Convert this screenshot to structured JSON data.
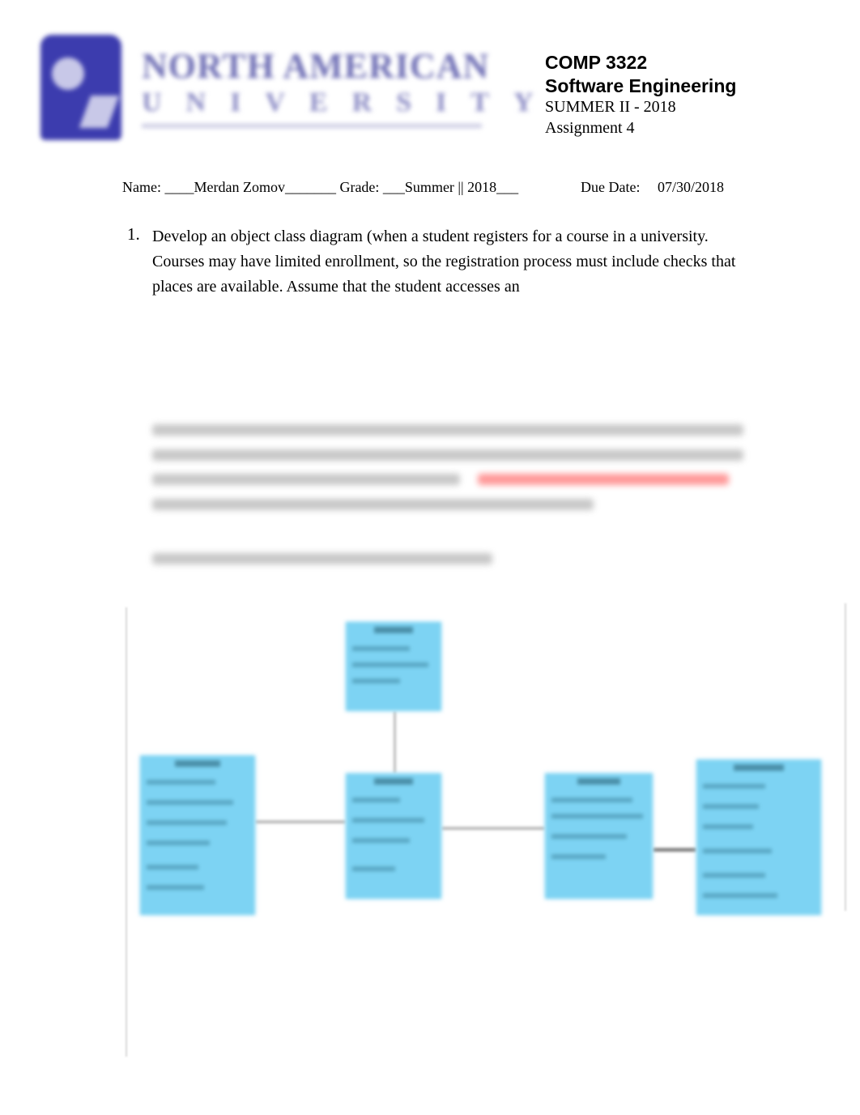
{
  "logo": {
    "name": "NORTH AMERICAN UNIVERSITY",
    "line1": "NORTH AMERICAN",
    "line2": "UNIVERSITY",
    "color": "#3c3cae"
  },
  "header": {
    "course_code": "COMP 3322",
    "course_name": "Software Engineering",
    "term": "SUMMER II - 2018",
    "assignment": "Assignment 4"
  },
  "info": {
    "name_line": "Name: ____Merdan Zomov_______ Grade: ___Summer || 2018___",
    "due_label": "Due Date:",
    "due_value": "07/30/2018"
  },
  "question": {
    "number": "1.",
    "text": "Develop an object class diagram  (when a student registers for a course in a university. Courses may have limited enrollment, so the registration process must include checks that places are available. Assume that the student accesses an"
  },
  "colors": {
    "class_box": "#7dd3f3",
    "highlight_text": "#ff4444"
  }
}
